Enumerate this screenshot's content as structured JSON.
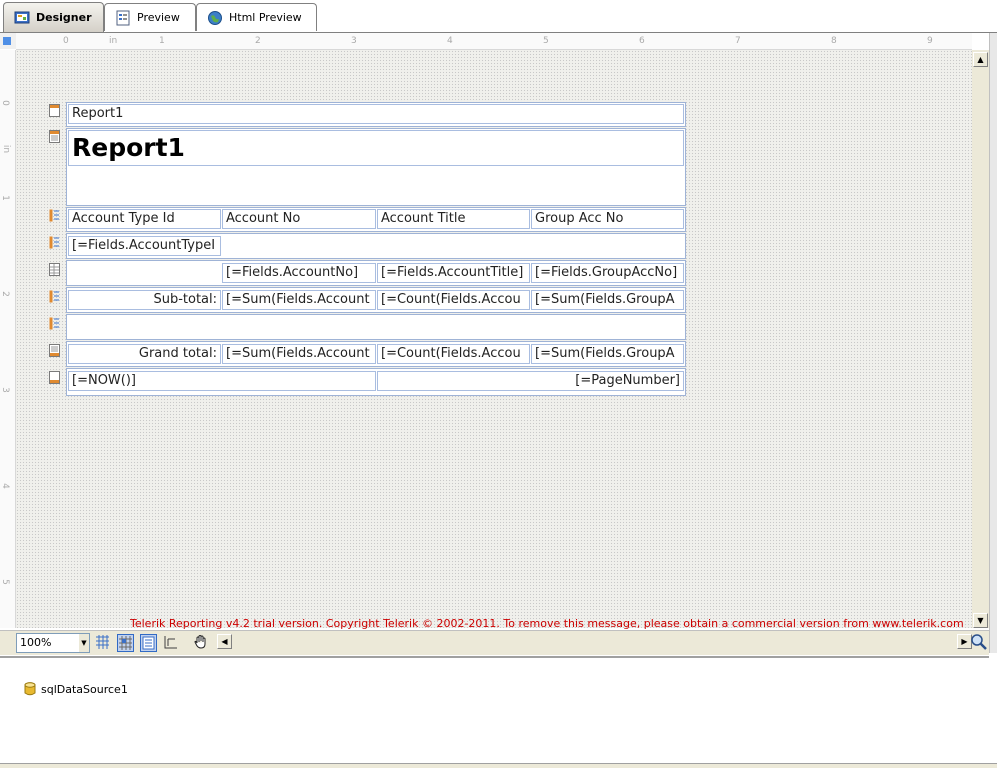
{
  "tabs": [
    {
      "label": "Designer",
      "icon": "designer-icon",
      "active": true
    },
    {
      "label": "Preview",
      "icon": "preview-icon",
      "active": false
    },
    {
      "label": "Html Preview",
      "icon": "globe-icon",
      "active": false
    }
  ],
  "ruler": {
    "unit": "in",
    "h_ticks": [
      "0",
      "in",
      "1",
      "2",
      "3",
      "4",
      "5",
      "6",
      "7",
      "8",
      "9"
    ],
    "v_ticks": [
      "0",
      "in",
      "1",
      "2",
      "3",
      "4",
      "5"
    ]
  },
  "report": {
    "page_header": {
      "text": "Report1"
    },
    "report_header": {
      "title": "Report1"
    },
    "group_header_columns": [
      "Account Type Id",
      "Account No",
      "Account Title",
      "Group Acc No"
    ],
    "group_header_field": "[=Fields.AccountTypeI",
    "detail": [
      "[=Fields.AccountNo]",
      "[=Fields.AccountTitle]",
      "[=Fields.GroupAccNo]"
    ],
    "group_footer": {
      "label": "Sub-total:",
      "values": [
        "[=Sum(Fields.Account",
        "[=Count(Fields.Accou",
        "[=Sum(Fields.GroupA"
      ]
    },
    "report_footer": {
      "label": "Grand total:",
      "values": [
        "[=Sum(Fields.Account",
        "[=Count(Fields.Accou",
        "[=Sum(Fields.GroupA"
      ]
    },
    "page_footer": {
      "left": "[=NOW()]",
      "right": "[=PageNumber]"
    }
  },
  "trial_notice": "Telerik Reporting v4.2 trial version. Copyright Telerik © 2002-2011. To remove this message, please obtain a commercial version from www.telerik.com",
  "toolbar": {
    "zoom": "100%"
  },
  "datasources": [
    {
      "name": "sqlDataSource1",
      "icon": "database-icon"
    }
  ],
  "colors": {
    "accent": "#316ac5",
    "section_border": "#9fb3d6",
    "trial_text": "#cc0000"
  }
}
